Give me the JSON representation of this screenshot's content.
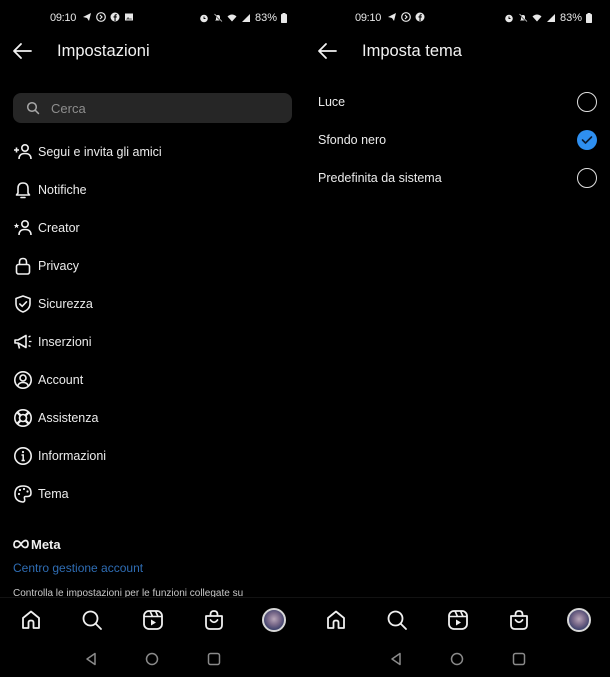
{
  "left_screen": {
    "status_bar": {
      "time": "09:10",
      "left_icons": [
        "telegram-icon",
        "shazam-icon",
        "facebook-icon",
        "gallery-icon"
      ],
      "right_icons": [
        "alarm-icon",
        "mute-icon",
        "wifi-icon",
        "signal-icon"
      ],
      "battery": "83%"
    },
    "app_bar": {
      "title": "Impostazioni"
    },
    "search": {
      "placeholder": "Cerca"
    },
    "menu": [
      {
        "label": "Segui e invita gli amici",
        "icon": "add-person-icon"
      },
      {
        "label": "Notifiche",
        "icon": "bell-icon"
      },
      {
        "label": "Creator",
        "icon": "creator-icon"
      },
      {
        "label": "Privacy",
        "icon": "lock-icon"
      },
      {
        "label": "Sicurezza",
        "icon": "shield-check-icon"
      },
      {
        "label": "Inserzioni",
        "icon": "megaphone-icon"
      },
      {
        "label": "Account",
        "icon": "account-circle-icon"
      },
      {
        "label": "Assistenza",
        "icon": "lifebuoy-icon"
      },
      {
        "label": "Informazioni",
        "icon": "info-icon"
      },
      {
        "label": "Tema",
        "icon": "palette-icon"
      }
    ],
    "meta": {
      "logo_text": "Meta",
      "link": "Centro gestione account",
      "description": "Controlla le impostazioni per le funzioni collegate su"
    }
  },
  "right_screen": {
    "status_bar": {
      "time": "09:10",
      "left_icons": [
        "telegram-icon",
        "shazam-icon",
        "facebook-icon"
      ],
      "right_icons": [
        "alarm-icon",
        "mute-icon",
        "wifi-icon",
        "signal-icon"
      ],
      "battery": "83%"
    },
    "app_bar": {
      "title": "Imposta tema"
    },
    "options": [
      {
        "label": "Luce",
        "selected": false
      },
      {
        "label": "Sfondo nero",
        "selected": true
      },
      {
        "label": "Predefinita da sistema",
        "selected": false
      }
    ]
  },
  "bottom_nav": [
    "home-icon",
    "search-icon",
    "reels-icon",
    "shop-icon",
    "profile-avatar"
  ],
  "system_nav": [
    "back-triangle-icon",
    "home-circle-icon",
    "recents-square-icon"
  ],
  "colors": {
    "accent": "#2e8ff0",
    "link": "#2f6db4",
    "search_bg": "#262626",
    "background": "#000000"
  }
}
